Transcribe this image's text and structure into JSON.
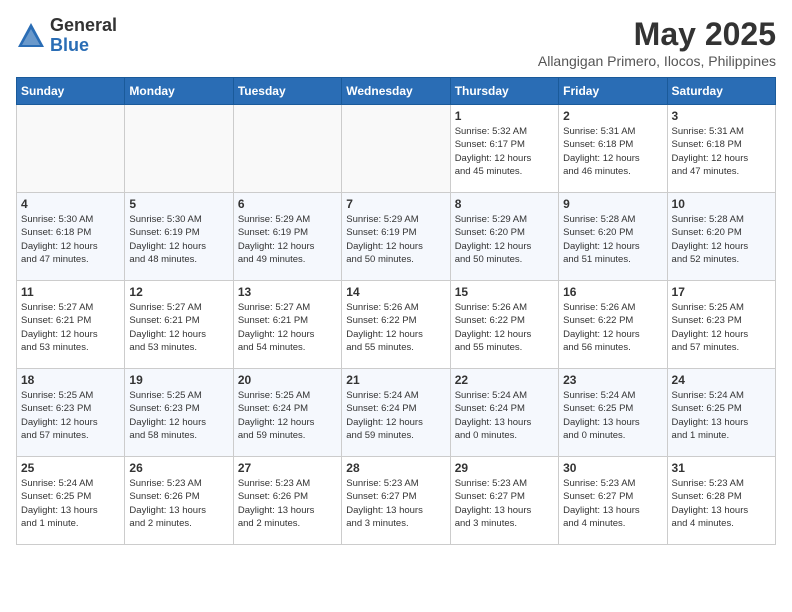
{
  "logo": {
    "general": "General",
    "blue": "Blue"
  },
  "title": "May 2025",
  "subtitle": "Allangigan Primero, Ilocos, Philippines",
  "weekdays": [
    "Sunday",
    "Monday",
    "Tuesday",
    "Wednesday",
    "Thursday",
    "Friday",
    "Saturday"
  ],
  "weeks": [
    [
      {
        "day": "",
        "info": ""
      },
      {
        "day": "",
        "info": ""
      },
      {
        "day": "",
        "info": ""
      },
      {
        "day": "",
        "info": ""
      },
      {
        "day": "1",
        "info": "Sunrise: 5:32 AM\nSunset: 6:17 PM\nDaylight: 12 hours\nand 45 minutes."
      },
      {
        "day": "2",
        "info": "Sunrise: 5:31 AM\nSunset: 6:18 PM\nDaylight: 12 hours\nand 46 minutes."
      },
      {
        "day": "3",
        "info": "Sunrise: 5:31 AM\nSunset: 6:18 PM\nDaylight: 12 hours\nand 47 minutes."
      }
    ],
    [
      {
        "day": "4",
        "info": "Sunrise: 5:30 AM\nSunset: 6:18 PM\nDaylight: 12 hours\nand 47 minutes."
      },
      {
        "day": "5",
        "info": "Sunrise: 5:30 AM\nSunset: 6:19 PM\nDaylight: 12 hours\nand 48 minutes."
      },
      {
        "day": "6",
        "info": "Sunrise: 5:29 AM\nSunset: 6:19 PM\nDaylight: 12 hours\nand 49 minutes."
      },
      {
        "day": "7",
        "info": "Sunrise: 5:29 AM\nSunset: 6:19 PM\nDaylight: 12 hours\nand 50 minutes."
      },
      {
        "day": "8",
        "info": "Sunrise: 5:29 AM\nSunset: 6:20 PM\nDaylight: 12 hours\nand 50 minutes."
      },
      {
        "day": "9",
        "info": "Sunrise: 5:28 AM\nSunset: 6:20 PM\nDaylight: 12 hours\nand 51 minutes."
      },
      {
        "day": "10",
        "info": "Sunrise: 5:28 AM\nSunset: 6:20 PM\nDaylight: 12 hours\nand 52 minutes."
      }
    ],
    [
      {
        "day": "11",
        "info": "Sunrise: 5:27 AM\nSunset: 6:21 PM\nDaylight: 12 hours\nand 53 minutes."
      },
      {
        "day": "12",
        "info": "Sunrise: 5:27 AM\nSunset: 6:21 PM\nDaylight: 12 hours\nand 53 minutes."
      },
      {
        "day": "13",
        "info": "Sunrise: 5:27 AM\nSunset: 6:21 PM\nDaylight: 12 hours\nand 54 minutes."
      },
      {
        "day": "14",
        "info": "Sunrise: 5:26 AM\nSunset: 6:22 PM\nDaylight: 12 hours\nand 55 minutes."
      },
      {
        "day": "15",
        "info": "Sunrise: 5:26 AM\nSunset: 6:22 PM\nDaylight: 12 hours\nand 55 minutes."
      },
      {
        "day": "16",
        "info": "Sunrise: 5:26 AM\nSunset: 6:22 PM\nDaylight: 12 hours\nand 56 minutes."
      },
      {
        "day": "17",
        "info": "Sunrise: 5:25 AM\nSunset: 6:23 PM\nDaylight: 12 hours\nand 57 minutes."
      }
    ],
    [
      {
        "day": "18",
        "info": "Sunrise: 5:25 AM\nSunset: 6:23 PM\nDaylight: 12 hours\nand 57 minutes."
      },
      {
        "day": "19",
        "info": "Sunrise: 5:25 AM\nSunset: 6:23 PM\nDaylight: 12 hours\nand 58 minutes."
      },
      {
        "day": "20",
        "info": "Sunrise: 5:25 AM\nSunset: 6:24 PM\nDaylight: 12 hours\nand 59 minutes."
      },
      {
        "day": "21",
        "info": "Sunrise: 5:24 AM\nSunset: 6:24 PM\nDaylight: 12 hours\nand 59 minutes."
      },
      {
        "day": "22",
        "info": "Sunrise: 5:24 AM\nSunset: 6:24 PM\nDaylight: 13 hours\nand 0 minutes."
      },
      {
        "day": "23",
        "info": "Sunrise: 5:24 AM\nSunset: 6:25 PM\nDaylight: 13 hours\nand 0 minutes."
      },
      {
        "day": "24",
        "info": "Sunrise: 5:24 AM\nSunset: 6:25 PM\nDaylight: 13 hours\nand 1 minute."
      }
    ],
    [
      {
        "day": "25",
        "info": "Sunrise: 5:24 AM\nSunset: 6:25 PM\nDaylight: 13 hours\nand 1 minute."
      },
      {
        "day": "26",
        "info": "Sunrise: 5:23 AM\nSunset: 6:26 PM\nDaylight: 13 hours\nand 2 minutes."
      },
      {
        "day": "27",
        "info": "Sunrise: 5:23 AM\nSunset: 6:26 PM\nDaylight: 13 hours\nand 2 minutes."
      },
      {
        "day": "28",
        "info": "Sunrise: 5:23 AM\nSunset: 6:27 PM\nDaylight: 13 hours\nand 3 minutes."
      },
      {
        "day": "29",
        "info": "Sunrise: 5:23 AM\nSunset: 6:27 PM\nDaylight: 13 hours\nand 3 minutes."
      },
      {
        "day": "30",
        "info": "Sunrise: 5:23 AM\nSunset: 6:27 PM\nDaylight: 13 hours\nand 4 minutes."
      },
      {
        "day": "31",
        "info": "Sunrise: 5:23 AM\nSunset: 6:28 PM\nDaylight: 13 hours\nand 4 minutes."
      }
    ]
  ]
}
